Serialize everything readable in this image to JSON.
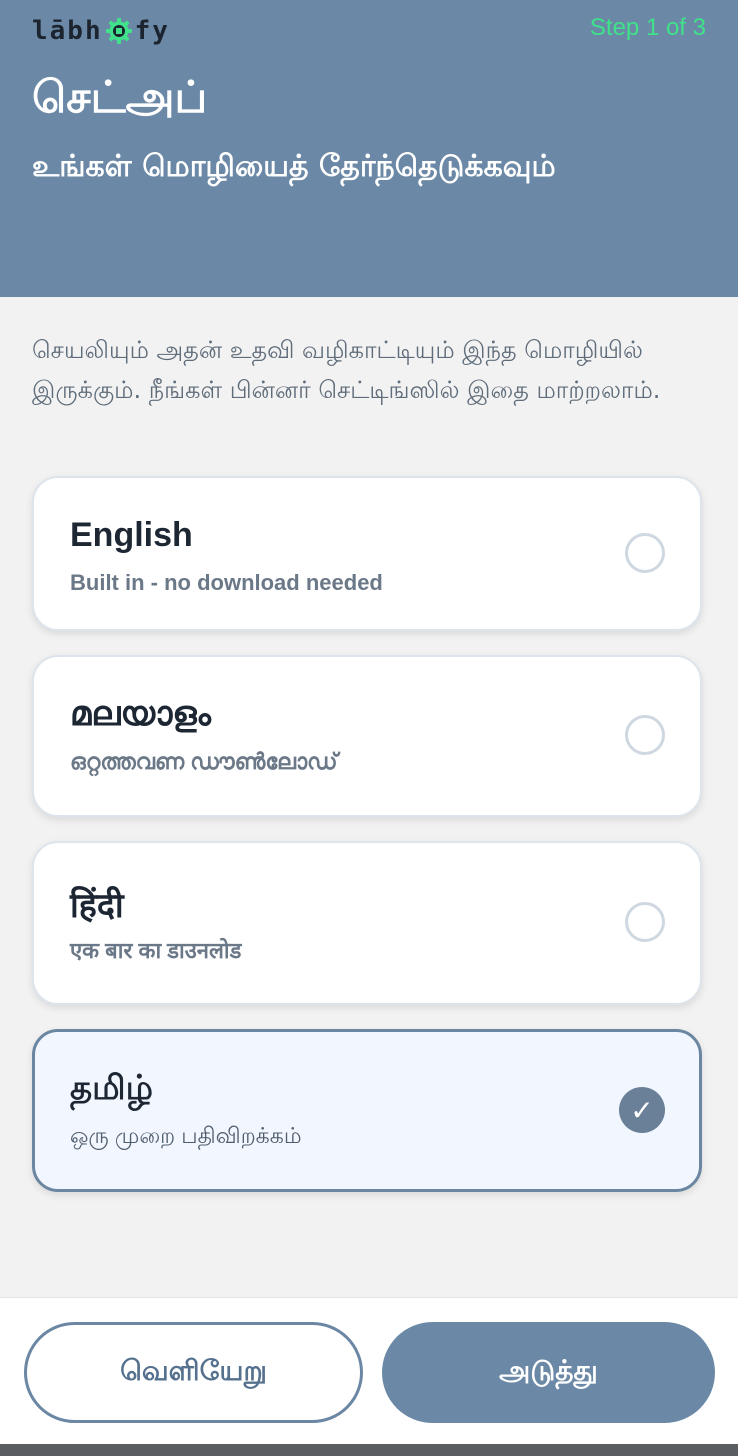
{
  "header": {
    "logo_text_left": "lābh",
    "logo_text_right": "fy",
    "step": "Step 1 of 3",
    "title": "செட்அப்",
    "subtitle": "உங்கள் மொழியைத் தேர்ந்தெடுக்கவும்"
  },
  "description": "செயலியும் அதன் உதவி வழிகாட்டியும் இந்த மொழியில் இருக்கும். நீங்கள் பின்னர் செட்டிங்ஸில் இதை மாற்றலாம்.",
  "languages": [
    {
      "name": "English",
      "description": "Built in - no download needed",
      "selected": false
    },
    {
      "name": "മലയാളം",
      "description": "ഒറ്റത്തവണ ഡൗൺലോഡ്",
      "selected": false
    },
    {
      "name": "हिंदी",
      "description": "एक बार का डाउनलोड",
      "selected": false
    },
    {
      "name": "தமிழ்",
      "description": "ஒரு முறை பதிவிறக்கம்",
      "selected": true
    }
  ],
  "check_glyph": "✓",
  "buttons": {
    "exit": "வெளியேறு",
    "next": "அடுத்து"
  },
  "colors": {
    "header_bg": "#6b89a6",
    "step_text": "#3fe28a",
    "logo_gear": "#3fe28a",
    "selected_check": "#6a8099"
  },
  "icons": {
    "logo_gear": "gear-icon",
    "radio": "radio-icon",
    "check": "check-icon"
  }
}
